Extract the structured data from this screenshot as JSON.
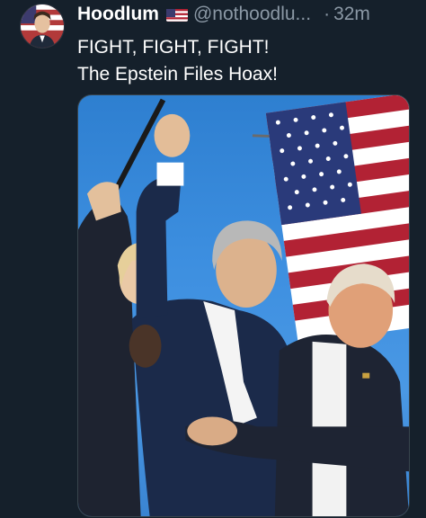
{
  "tweet": {
    "display_name": "Hoodlum",
    "flag_icon": "us-flag-icon",
    "handle": "@nothoodlu...",
    "separator": "·",
    "timestamp": "32m",
    "text_line1": "FIGHT, FIGHT, FIGHT!",
    "text_line2": "The Epstein Files Hoax!"
  },
  "colors": {
    "background": "#15202b",
    "secondary_text": "#8b98a5",
    "primary_text": "#ffffff",
    "border": "#38444d"
  }
}
